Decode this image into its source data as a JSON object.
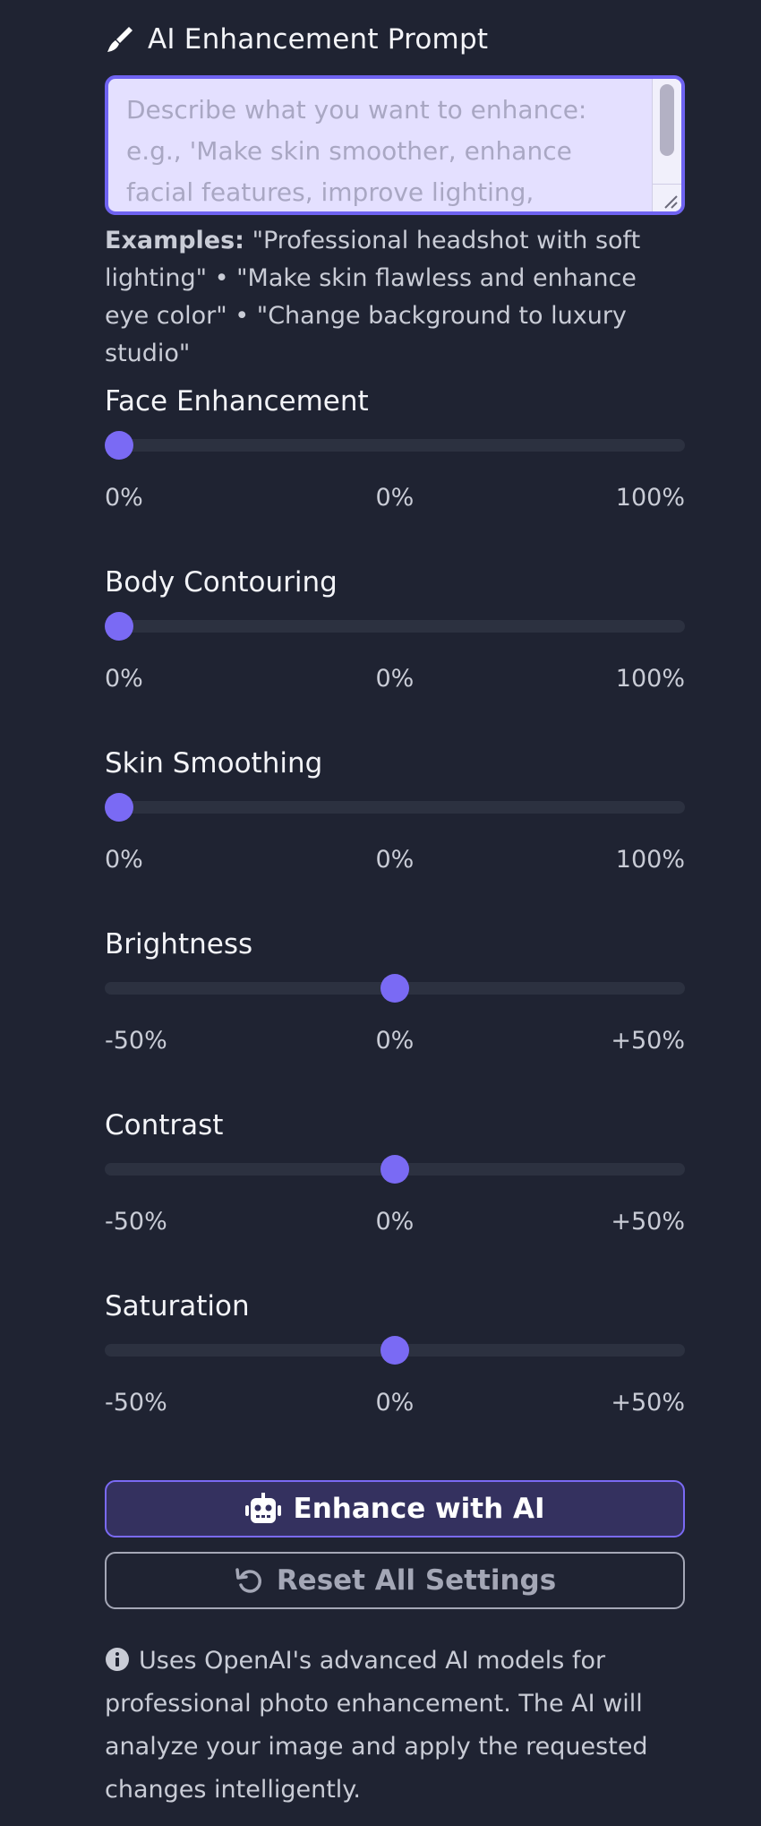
{
  "header": {
    "icon": "brush-icon",
    "title": "AI Enhancement Prompt"
  },
  "prompt": {
    "value": "",
    "placeholder": "Describe what you want to enhance: e.g., 'Make skin smoother, enhance facial features, improve lighting, change"
  },
  "examples": {
    "label": "Examples:",
    "text": " \"Professional headshot with soft lighting\" • \"Make skin flawless and enhance eye color\" • \"Change background to luxury studio\""
  },
  "sliders": [
    {
      "label": "Face Enhancement",
      "min_label": "0%",
      "value_label": "0%",
      "max_label": "100%",
      "value": 0,
      "min": 0,
      "max": 100
    },
    {
      "label": "Body Contouring",
      "min_label": "0%",
      "value_label": "0%",
      "max_label": "100%",
      "value": 0,
      "min": 0,
      "max": 100
    },
    {
      "label": "Skin Smoothing",
      "min_label": "0%",
      "value_label": "0%",
      "max_label": "100%",
      "value": 0,
      "min": 0,
      "max": 100
    },
    {
      "label": "Brightness",
      "min_label": "-50%",
      "value_label": "0%",
      "max_label": "+50%",
      "value": 0,
      "min": -50,
      "max": 50
    },
    {
      "label": "Contrast",
      "min_label": "-50%",
      "value_label": "0%",
      "max_label": "+50%",
      "value": 0,
      "min": -50,
      "max": 50
    },
    {
      "label": "Saturation",
      "min_label": "-50%",
      "value_label": "0%",
      "max_label": "+50%",
      "value": 0,
      "min": -50,
      "max": 50
    }
  ],
  "buttons": {
    "enhance": {
      "label": "Enhance with AI",
      "icon": "robot-icon"
    },
    "reset": {
      "label": "Reset All Settings",
      "icon": "undo-icon"
    }
  },
  "info": {
    "icon": "info-icon",
    "text": "Uses OpenAI's advanced AI models for professional photo enhancement. The AI will analyze your image and apply the requested changes intelligently."
  },
  "colors": {
    "background": "#1f2332",
    "accent": "#7a6af4",
    "prompt_bg": "#e4e0ff",
    "track": "#2c3140"
  }
}
